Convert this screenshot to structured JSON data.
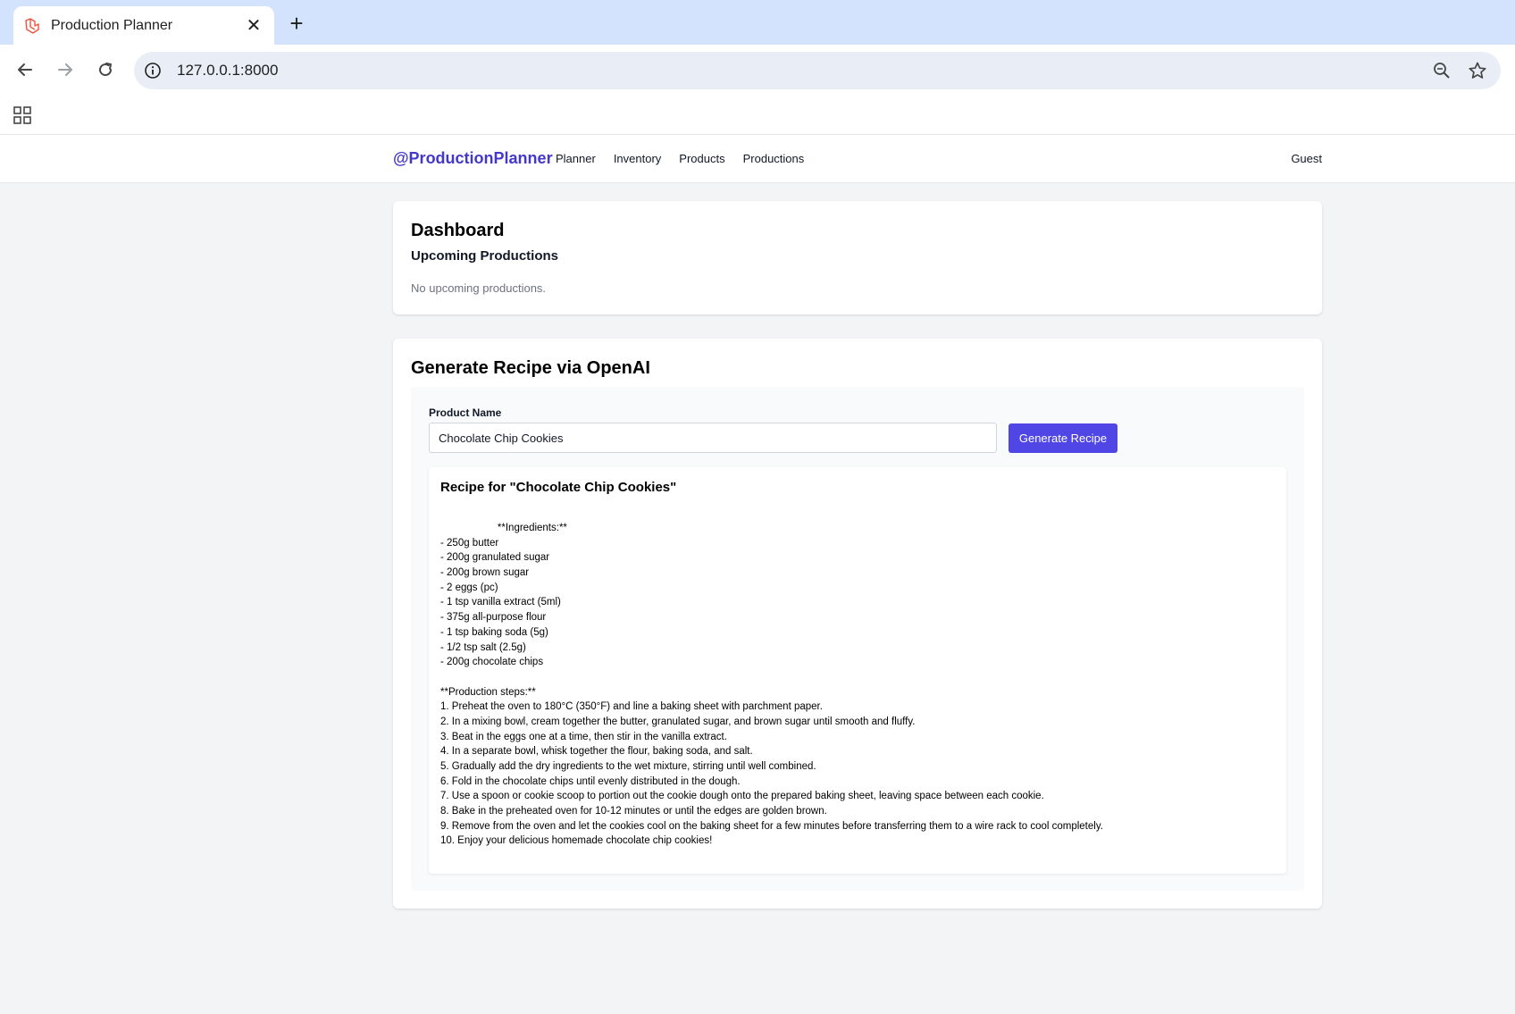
{
  "browser": {
    "tab_title": "Production Planner",
    "address": "127.0.0.1:8000"
  },
  "nav": {
    "brand": "@ProductionPlanner",
    "links": [
      "Planner",
      "Inventory",
      "Products",
      "Productions"
    ],
    "user": "Guest"
  },
  "dashboard": {
    "title": "Dashboard",
    "subtitle": "Upcoming Productions",
    "empty_text": "No upcoming productions."
  },
  "generator": {
    "title": "Generate Recipe via OpenAI",
    "field_label": "Product Name",
    "product_value": "Chocolate Chip Cookies",
    "button_label": "Generate Recipe",
    "recipe_title": "Recipe for \"Chocolate Chip Cookies\"",
    "recipe_lines": [
      "                    **Ingredients:**",
      "- 250g butter",
      "- 200g granulated sugar",
      "- 200g brown sugar",
      "- 2 eggs (pc)",
      "- 1 tsp vanilla extract (5ml)",
      "- 375g all-purpose flour",
      "- 1 tsp baking soda (5g)",
      "- 1/2 tsp salt (2.5g)",
      "- 200g chocolate chips",
      "",
      "**Production steps:**",
      "1. Preheat the oven to 180°C (350°F) and line a baking sheet with parchment paper.",
      "2. In a mixing bowl, cream together the butter, granulated sugar, and brown sugar until smooth and fluffy.",
      "3. Beat in the eggs one at a time, then stir in the vanilla extract.",
      "4. In a separate bowl, whisk together the flour, baking soda, and salt.",
      "5. Gradually add the dry ingredients to the wet mixture, stirring until well combined.",
      "6. Fold in the chocolate chips until evenly distributed in the dough.",
      "7. Use a spoon or cookie scoop to portion out the cookie dough onto the prepared baking sheet, leaving space between each cookie.",
      "8. Bake in the preheated oven for 10-12 minutes or until the edges are golden brown.",
      "9. Remove from the oven and let the cookies cool on the baking sheet for a few minutes before transferring them to a wire rack to cool completely.",
      "10. Enjoy your delicious homemade chocolate chip cookies!"
    ]
  }
}
